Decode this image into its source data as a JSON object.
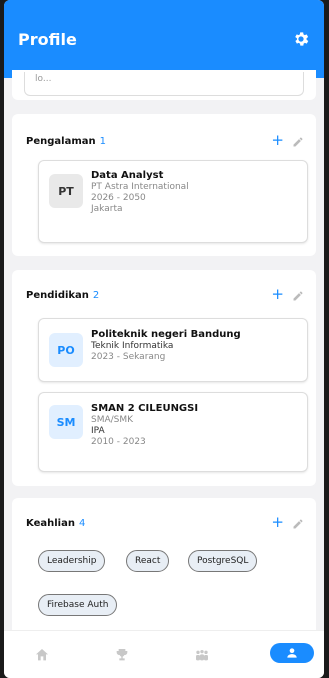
{
  "header": {
    "title": "Profile",
    "settings_icon": "gear-icon"
  },
  "top_peek": {
    "text": "lo..."
  },
  "pengalaman": {
    "title": "Pengalaman",
    "count": "1",
    "items": [
      {
        "badge": "PT",
        "name": "Data Analyst",
        "company": "PT Astra International",
        "period": "2026 - 2050",
        "location": "Jakarta"
      }
    ]
  },
  "pendidikan": {
    "title": "Pendidikan",
    "count": "2",
    "items": [
      {
        "badge": "PO",
        "name": "Politeknik negeri Bandung",
        "major": "Teknik Informatika",
        "period": "2023 - Sekarang"
      },
      {
        "badge": "SM",
        "name": "SMAN 2 CILEUNGSI",
        "level": "SMA/SMK",
        "major": "IPA",
        "period": "2010 - 2023"
      }
    ]
  },
  "keahlian": {
    "title": "Keahlian",
    "count": "4",
    "skills": [
      "Leadership",
      "React",
      "PostgreSQL",
      "Firebase Auth"
    ]
  },
  "nav": {
    "items": [
      "home-icon",
      "trophy-icon",
      "people-icon",
      "profile-icon"
    ],
    "active": "profile-icon"
  },
  "colors": {
    "accent": "#1a8cff",
    "background": "#f2f2f4"
  }
}
